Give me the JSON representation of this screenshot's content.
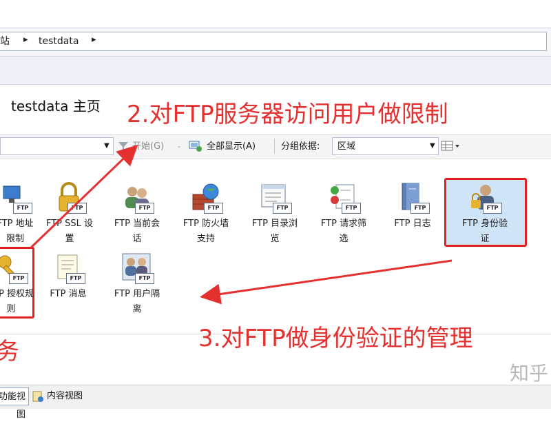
{
  "breadcrumb": {
    "site": "网站",
    "node": "testdata"
  },
  "page": {
    "title": "testdata 主页"
  },
  "toolbar": {
    "start_label": "开始(G)",
    "show_all_label": "全部显示(A)",
    "group_by_label": "分组依据:",
    "group_by_value": "区域"
  },
  "features": [
    {
      "label_1": "FTP 地址",
      "label_2": "限制"
    },
    {
      "label_1": "FTP SSL 设",
      "label_2": "置"
    },
    {
      "label_1": "FTP 当前会",
      "label_2": "话"
    },
    {
      "label_1": "FTP 防火墙",
      "label_2": "支持"
    },
    {
      "label_1": "FTP 目录浏",
      "label_2": "览"
    },
    {
      "label_1": "FTP 请求筛",
      "label_2": "选"
    },
    {
      "label_1": "FTP 日志",
      "label_2": ""
    },
    {
      "label_1": "FTP 身份验",
      "label_2": "证"
    },
    {
      "label_1": "FTP 授权规",
      "label_2": "则"
    },
    {
      "label_1": "FTP 消息",
      "label_2": ""
    },
    {
      "label_1": "FTP 用户隔",
      "label_2": "离"
    }
  ],
  "badge": "FTP",
  "annotations": {
    "a2": "2.对FTP服务器访问用户做限制",
    "a3": "3.对FTP做身份验证的管理",
    "a1_fragment": "务"
  },
  "bottom_tabs": {
    "features_view": "功能视图",
    "content_view": "内容视图"
  },
  "watermark": "知乎",
  "colors": {
    "annotation": "#e53030",
    "highlight_box": "#e02020"
  }
}
